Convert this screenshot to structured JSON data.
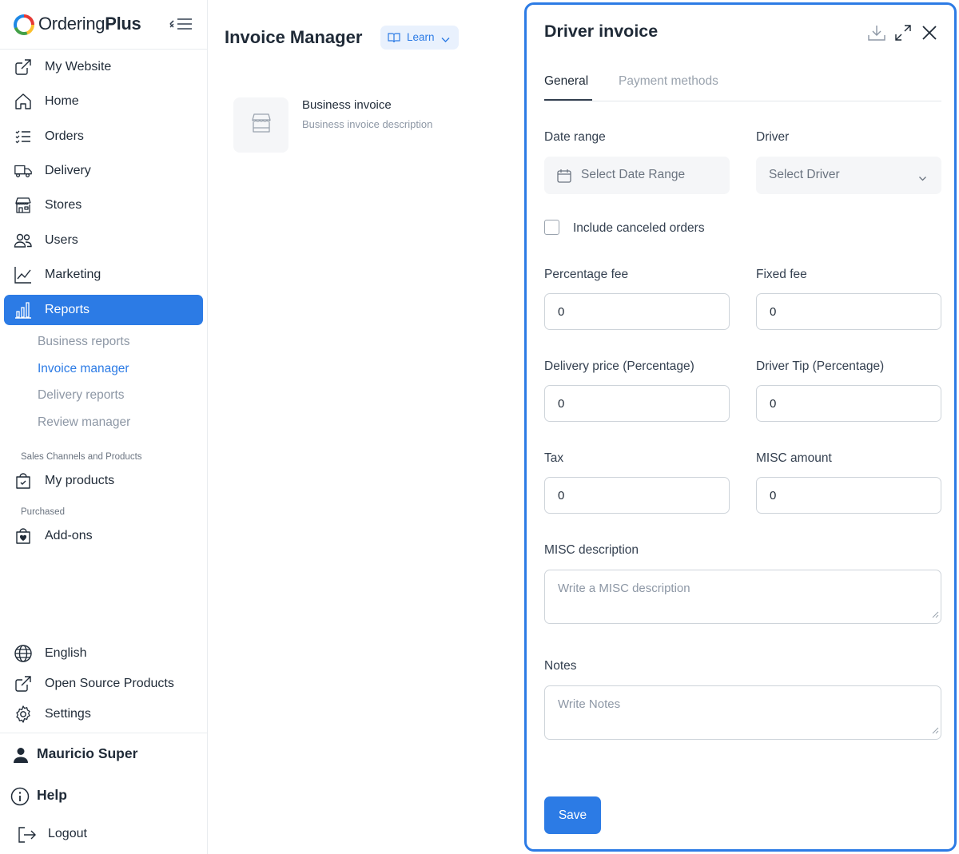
{
  "brand": {
    "name_regular": "Ordering",
    "name_bold": "Plus"
  },
  "sidebar": {
    "items": [
      {
        "label": "My Website",
        "icon": "external-link-icon"
      },
      {
        "label": "Home",
        "icon": "home-icon"
      },
      {
        "label": "Orders",
        "icon": "list-icon"
      },
      {
        "label": "Delivery",
        "icon": "truck-icon"
      },
      {
        "label": "Stores",
        "icon": "shop-icon"
      },
      {
        "label": "Users",
        "icon": "users-icon"
      },
      {
        "label": "Marketing",
        "icon": "graph-up-icon"
      },
      {
        "label": "Reports",
        "icon": "bar-chart-icon",
        "active": true
      }
    ],
    "report_subitems": [
      {
        "label": "Business reports"
      },
      {
        "label": "Invoice manager",
        "active": true
      },
      {
        "label": "Delivery reports"
      },
      {
        "label": "Review manager"
      }
    ],
    "sales_caption": "Sales Channels and Products",
    "my_products": "My products",
    "purchased_caption": "Purchased",
    "addons": "Add-ons",
    "language": "English",
    "open_source": "Open Source Products",
    "settings": "Settings",
    "user_name": "Mauricio Super",
    "help": "Help",
    "logout": "Logout"
  },
  "main": {
    "title": "Invoice Manager",
    "learn_label": "Learn",
    "card": {
      "title": "Business invoice",
      "description": "Business invoice description"
    }
  },
  "drawer": {
    "title": "Driver invoice",
    "tabs": [
      {
        "label": "General",
        "active": true
      },
      {
        "label": "Payment methods"
      }
    ],
    "date_range_label": "Date range",
    "date_range_placeholder": "Select Date Range",
    "driver_label": "Driver",
    "driver_placeholder": "Select Driver",
    "include_canceled_label": "Include canceled orders",
    "include_canceled_checked": false,
    "percentage_fee_label": "Percentage fee",
    "percentage_fee_value": "0",
    "fixed_fee_label": "Fixed fee",
    "fixed_fee_value": "0",
    "delivery_price_label": "Delivery price (Percentage)",
    "delivery_price_value": "0",
    "driver_tip_label": "Driver Tip (Percentage)",
    "driver_tip_value": "0",
    "tax_label": "Tax",
    "tax_value": "0",
    "misc_amount_label": "MISC amount",
    "misc_amount_value": "0",
    "misc_description_label": "MISC description",
    "misc_description_placeholder": "Write a MISC description",
    "notes_label": "Notes",
    "notes_placeholder": "Write Notes",
    "save_label": "Save"
  },
  "colors": {
    "accent": "#2c7be5",
    "text": "#1f2a37",
    "muted": "#8d97a5"
  }
}
